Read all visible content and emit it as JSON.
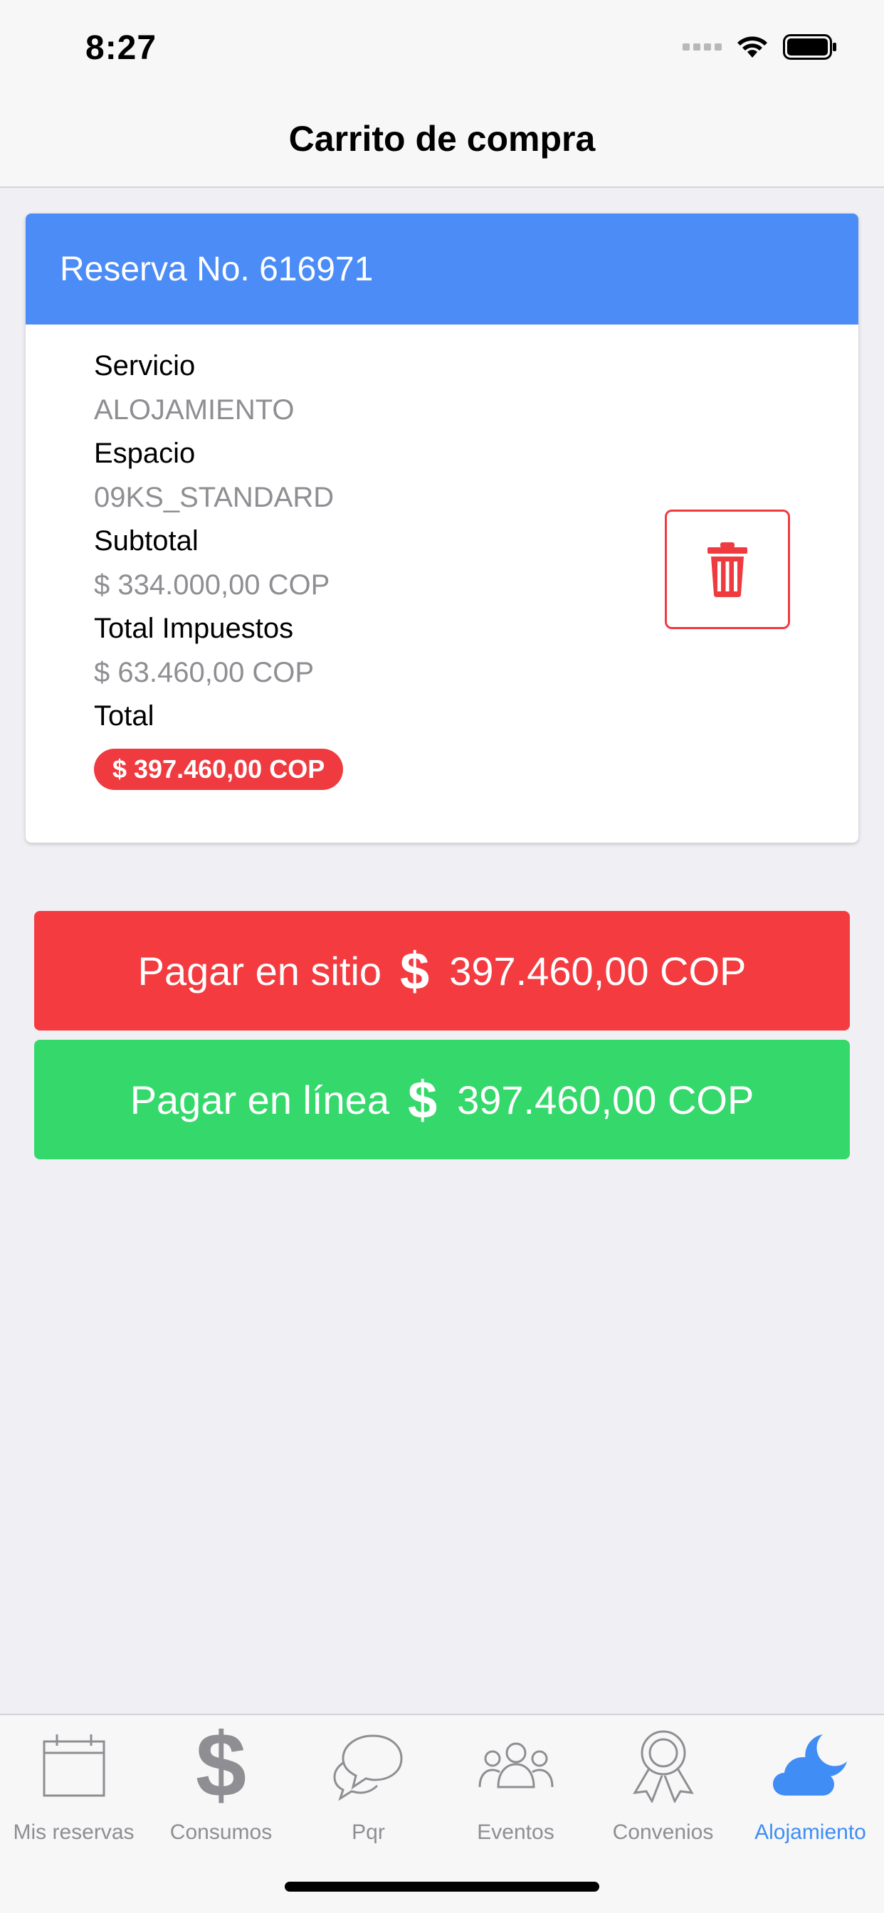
{
  "status_bar": {
    "time": "8:27"
  },
  "nav": {
    "title": "Carrito de compra"
  },
  "reservation": {
    "header": "Reserva No. 616971",
    "service_label": "Servicio",
    "service_value": "ALOJAMIENTO",
    "space_label": "Espacio",
    "space_value": "09KS_STANDARD",
    "subtotal_label": "Subtotal",
    "subtotal_value": "$ 334.000,00 COP",
    "taxes_label": "Total Impuestos",
    "taxes_value": "$ 63.460,00 COP",
    "total_label": "Total",
    "total_value": "$ 397.460,00 COP",
    "delete_icon": "trash-icon"
  },
  "payment": {
    "on_site_label": "Pagar en sitio",
    "on_site_amount": "397.460,00 COP",
    "online_label": "Pagar en línea",
    "online_amount": "397.460,00 COP",
    "currency_symbol": "$"
  },
  "tabs": [
    {
      "label": "Mis reservas",
      "icon": "calendar-icon",
      "active": false
    },
    {
      "label": "Consumos",
      "icon": "dollar-icon",
      "active": false
    },
    {
      "label": "Pqr",
      "icon": "chat-bubbles-icon",
      "active": false
    },
    {
      "label": "Eventos",
      "icon": "people-group-icon",
      "active": false
    },
    {
      "label": "Convenios",
      "icon": "award-ribbon-icon",
      "active": false
    },
    {
      "label": "Alojamiento",
      "icon": "cloud-moon-icon",
      "active": true
    }
  ],
  "colors": {
    "header_blue": "#4C8CF6",
    "danger_red": "#F43B40",
    "success_green": "#35D86A",
    "tab_active": "#3F8DF5",
    "muted_gray": "#8E8E93"
  }
}
